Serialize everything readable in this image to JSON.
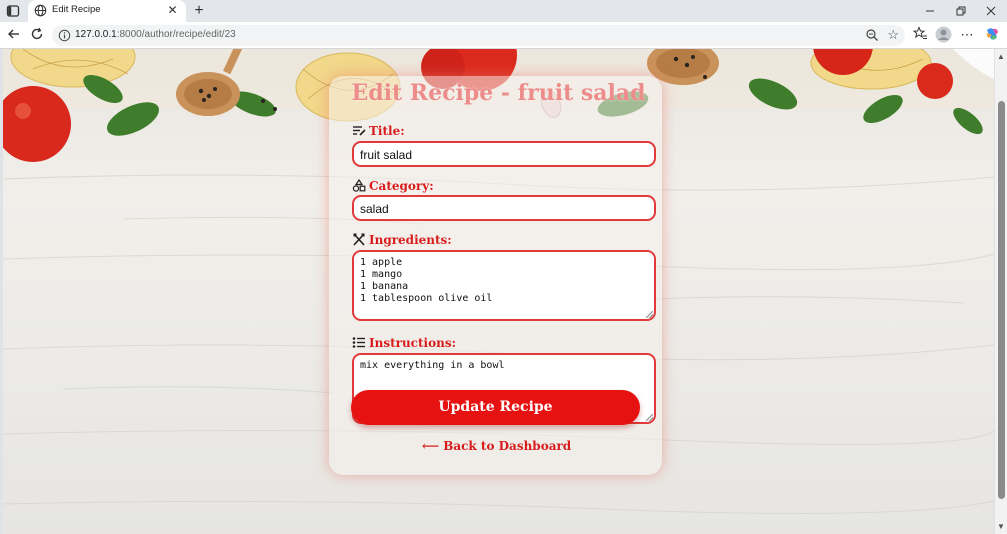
{
  "browser": {
    "tab_title": "Edit Recipe",
    "url_host": "127.0.0.1",
    "url_rest": ":8000/author/recipe/edit/23",
    "new_tab_glyph": "+",
    "close_glyph": "✕",
    "icons": [
      "sidebar-toggle-icon",
      "globe-icon",
      "back-icon",
      "reload-icon",
      "info-icon",
      "zoom-icon",
      "star-icon",
      "favorites-icon",
      "profile-icon",
      "more-icon",
      "copilot-icon"
    ]
  },
  "page": {
    "title": "Edit Recipe - fruit salad",
    "fields": {
      "title_label": "Title:",
      "title_value": "fruit salad",
      "category_label": "Category:",
      "category_value": "salad",
      "ingredients_label": "Ingredients:",
      "ingredients_lines": [
        "1 apple",
        "1 mango",
        "1 banana",
        "1 tablespoon olive oil"
      ],
      "instructions_label": "Instructions:",
      "instructions_lines": [
        "mix everything in a bowl"
      ]
    },
    "submit_label": "Update Recipe",
    "back_label": "⟵ Back to Dashboard"
  },
  "colors": {
    "accent": "#e61212",
    "label": "#d81c1c",
    "field_border": "#e03a3a"
  }
}
